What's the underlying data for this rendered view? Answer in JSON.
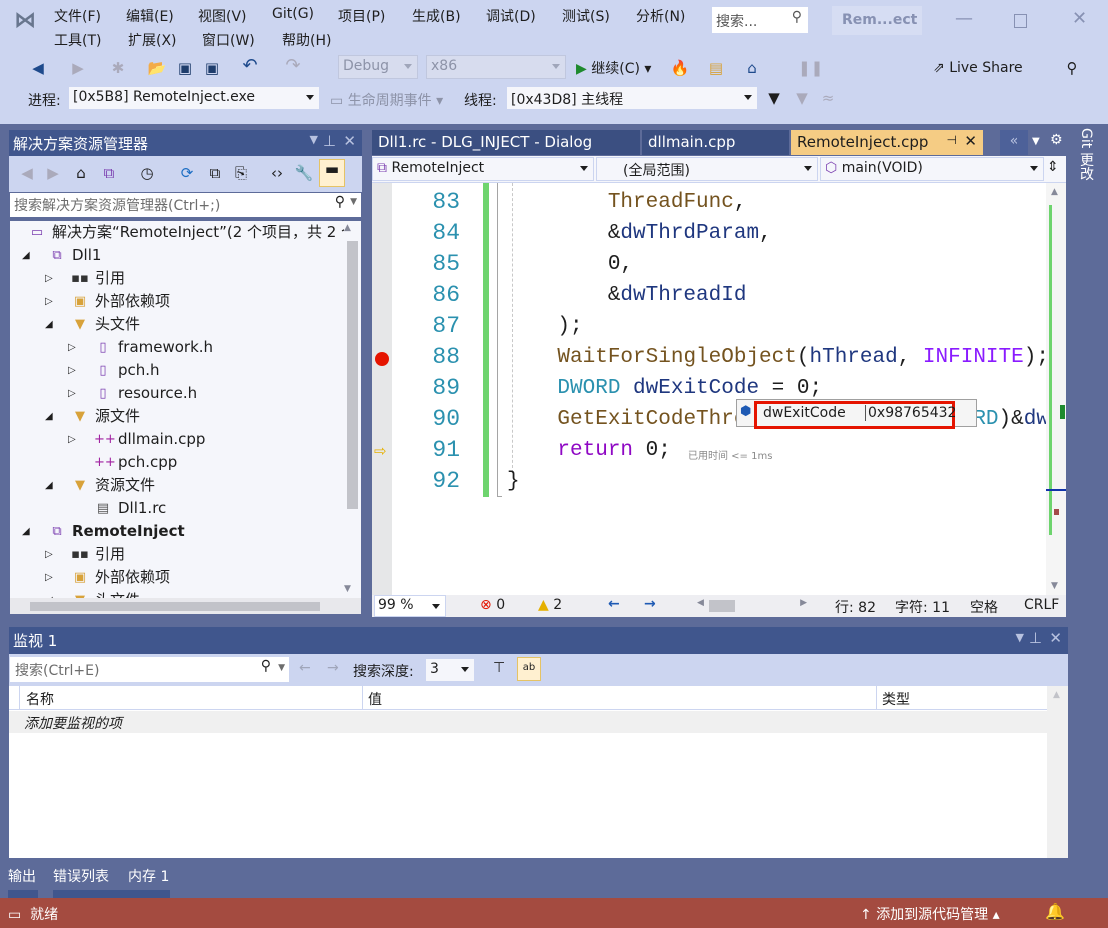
{
  "window": {
    "title_badge": "Rem...ect",
    "search_placeholder": "搜索...",
    "menu": [
      "文件(F)",
      "编辑(E)",
      "视图(V)",
      "Git(G)",
      "项目(P)",
      "生成(B)",
      "调试(D)",
      "测试(S)",
      "分析(N)",
      "工具(T)",
      "扩展(X)",
      "窗口(W)",
      "帮助(H)"
    ]
  },
  "toolbar": {
    "config": "Debug",
    "platform": "x86",
    "continue_label": "继续(C)",
    "live_share": "Live Share",
    "process_label": "进程:",
    "process_value": "[0x5B8] RemoteInject.exe",
    "lifecycle_label": "生命周期事件",
    "thread_label": "线程:",
    "thread_value": "[0x43D8] 主线程"
  },
  "solution_explorer": {
    "title": "解决方案资源管理器",
    "search_placeholder": "搜索解决方案资源管理器(Ctrl+;)",
    "items": [
      {
        "label": "解决方案“RemoteInject”(2 个项目，共 2 个",
        "level": 0,
        "expander": "none",
        "icon": "solution-icon"
      },
      {
        "label": "Dll1",
        "level": 0,
        "expander": "expanded",
        "icon": "project-icon"
      },
      {
        "label": "引用",
        "level": 1,
        "expander": "collapsed",
        "icon": "references-icon"
      },
      {
        "label": "外部依赖项",
        "level": 1,
        "expander": "collapsed",
        "icon": "external-deps-icon"
      },
      {
        "label": "头文件",
        "level": 1,
        "expander": "expanded",
        "icon": "filter-folder-icon"
      },
      {
        "label": "framework.h",
        "level": 2,
        "expander": "collapsed",
        "icon": "header-file-icon"
      },
      {
        "label": "pch.h",
        "level": 2,
        "expander": "collapsed",
        "icon": "header-file-icon"
      },
      {
        "label": "resource.h",
        "level": 2,
        "expander": "collapsed",
        "icon": "header-file-icon"
      },
      {
        "label": "源文件",
        "level": 1,
        "expander": "expanded",
        "icon": "filter-folder-icon"
      },
      {
        "label": "dllmain.cpp",
        "level": 2,
        "expander": "collapsed",
        "icon": "cpp-file-icon"
      },
      {
        "label": "pch.cpp",
        "level": 2,
        "expander": "none",
        "icon": "cpp-file-icon"
      },
      {
        "label": "资源文件",
        "level": 1,
        "expander": "expanded",
        "icon": "filter-folder-icon"
      },
      {
        "label": "Dll1.rc",
        "level": 2,
        "expander": "none",
        "icon": "rc-file-icon"
      },
      {
        "label": "RemoteInject",
        "level": 0,
        "expander": "expanded",
        "icon": "project-icon",
        "bold": true
      },
      {
        "label": "引用",
        "level": 1,
        "expander": "collapsed",
        "icon": "references-icon"
      },
      {
        "label": "外部依赖项",
        "level": 1,
        "expander": "collapsed",
        "icon": "external-deps-icon"
      },
      {
        "label": "头文件",
        "level": 1,
        "expander": "expanded",
        "icon": "filter-folder-icon"
      }
    ]
  },
  "editor": {
    "tabs": [
      {
        "label": "Dll1.rc - DLG_INJECT - Dialog",
        "active": false
      },
      {
        "label": "dllmain.cpp",
        "active": false
      },
      {
        "label": "RemoteInject.cpp",
        "active": true
      }
    ],
    "side_tab": "Git 更改",
    "nav_project": "RemoteInject",
    "nav_scope": "(全局范围)",
    "nav_member": "main(VOID)",
    "lines": [
      {
        "num": "83",
        "text": "        ThreadFunc,"
      },
      {
        "num": "84",
        "text": "        &dwThrdParam,"
      },
      {
        "num": "85",
        "text": "        0,"
      },
      {
        "num": "86",
        "text": "        &dwThreadId"
      },
      {
        "num": "87",
        "text": "    );"
      },
      {
        "num": "88",
        "text": "    WaitForSingleObject(hThread, INFINITE);",
        "breakpoint": true
      },
      {
        "num": "89",
        "text": "    DWORD dwExitCode = 0;"
      },
      {
        "num": "90",
        "text": "    GetExitCodeThread(hThread, (LPDWORD)&dwExitCode);"
      },
      {
        "num": "91",
        "text": "    return 0;",
        "current": true
      },
      {
        "num": "92",
        "text": "}"
      }
    ],
    "perf_tip": "已用时间 <= 1ms",
    "datatip": {
      "name": "dwExitCode",
      "value": "0x98765432"
    },
    "zoom": "99 %",
    "errors": "0",
    "warnings": "2",
    "line": "行: 82",
    "char": "字符: 11",
    "whitespace": "空格",
    "eol": "CRLF"
  },
  "watch": {
    "title": "监视 1",
    "search_placeholder": "搜索(Ctrl+E)",
    "depth_label": "搜索深度:",
    "depth_value": "3",
    "columns": [
      "名称",
      "值",
      "类型"
    ],
    "add_item": "添加要监视的项"
  },
  "bottom_tabs": [
    "输出",
    "错误列表",
    "内存 1"
  ],
  "status": {
    "ready": "就绪",
    "source_control": "添加到源代码管理"
  },
  "colors": {
    "status_bar": "#a44b40",
    "panel_header": "#40568d",
    "chrome": "#ccd5f0",
    "active_tab": "#f5cc84",
    "highlight": "#e51400"
  }
}
